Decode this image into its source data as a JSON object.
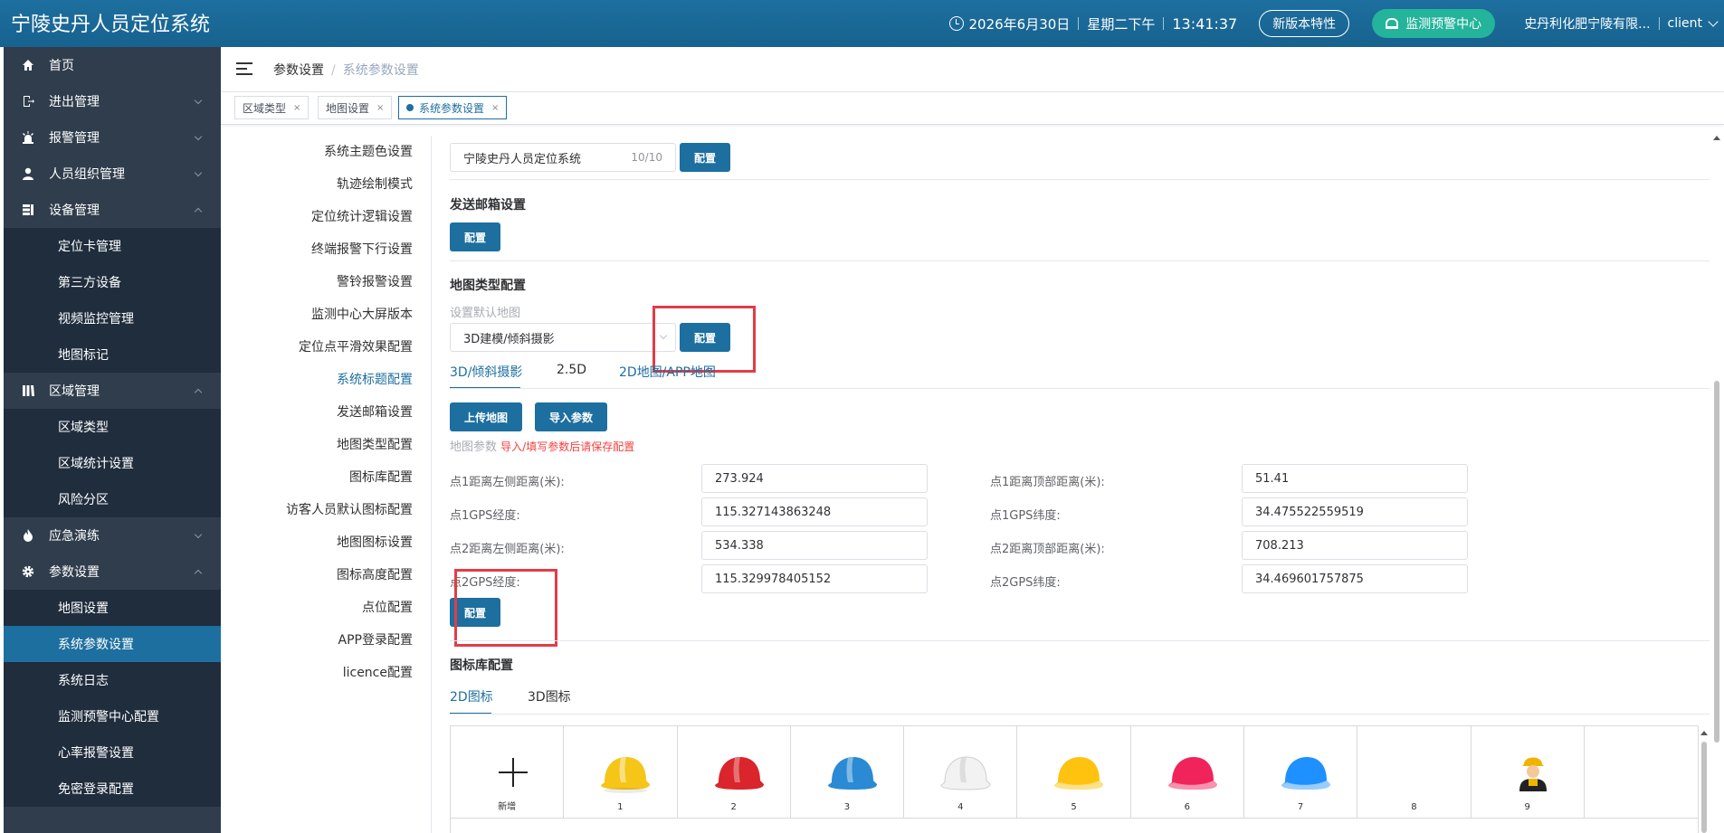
{
  "header": {
    "title": "宁陵史丹人员定位系统",
    "date": "2026年6月30日",
    "weekday": "星期二下午",
    "time": "13:41:37",
    "new_features": "新版本特性",
    "alarm_center": "监测预警中心",
    "company": "史丹利化肥宁陵有限...",
    "user": "client"
  },
  "colors": {
    "primary": "#1d6f9f",
    "sidebar": "#2f3d4c",
    "alarm": "#24b39b",
    "highlight_box": "#e23c48"
  },
  "sidebar": {
    "items": [
      {
        "label": "首页",
        "icon": "home-icon"
      },
      {
        "label": "进出管理",
        "icon": "exit-icon",
        "arrow": "down"
      },
      {
        "label": "报警管理",
        "icon": "alarm-light-icon",
        "arrow": "down"
      },
      {
        "label": "人员组织管理",
        "icon": "user-icon",
        "arrow": "down"
      },
      {
        "label": "设备管理",
        "icon": "device-icon",
        "arrow": "up"
      }
    ],
    "device_sub": [
      "定位卡管理",
      "第三方设备",
      "视频监控管理",
      "地图标记"
    ],
    "area": {
      "label": "区域管理",
      "icon": "area-icon"
    },
    "area_sub": [
      "区域类型",
      "区域统计设置",
      "风险分区"
    ],
    "drill": {
      "label": "应急演练",
      "icon": "fire-icon"
    },
    "params": {
      "label": "参数设置",
      "icon": "gear-icon"
    },
    "params_sub": [
      "地图设置",
      "系统参数设置",
      "系统日志",
      "监测预警中心配置",
      "心率报警设置",
      "免密登录配置"
    ]
  },
  "breadcrumb": {
    "parent": "参数设置",
    "current": "系统参数设置"
  },
  "tabs": [
    "区域类型",
    "地图设置",
    "系统参数设置"
  ],
  "settings_nav": [
    "系统主题色设置",
    "轨迹绘制模式",
    "定位统计逻辑设置",
    "终端报警下行设置",
    "警铃报警设置",
    "监测中心大屏版本",
    "定位点平滑效果配置",
    "系统标题配置",
    "发送邮箱设置",
    "地图类型配置",
    "图标库配置",
    "访客人员默认图标配置",
    "地图图标设置",
    "图标高度配置",
    "点位配置",
    "APP登录配置",
    "licence配置"
  ],
  "title_config": {
    "value": "宁陵史丹人员定位系统",
    "count": "10/10",
    "button": "配置"
  },
  "mail": {
    "title": "发送邮箱设置",
    "button": "配置"
  },
  "map_type": {
    "title": "地图类型配置",
    "default_label": "设置默认地图",
    "selected": "3D建模/倾斜摄影",
    "button": "配置",
    "tabs": [
      "3D/倾斜摄影",
      "2.5D",
      "2D地图/APP地图"
    ],
    "upload": "上传地图",
    "import": "导入参数",
    "params_label": "地图参数",
    "params_hint": "导入/填写参数后请保存配置",
    "fields": [
      {
        "label": "点1距离左侧距离(米):",
        "value": "273.924",
        "label2": "点1距离顶部距离(米):",
        "value2": "51.41"
      },
      {
        "label": "点1GPS经度:",
        "value": "115.327143863248",
        "label2": "点1GPS纬度:",
        "value2": "34.475522559519"
      },
      {
        "label": "点2距离左侧距离(米):",
        "value": "534.338",
        "label2": "点2距离顶部距离(米):",
        "value2": "708.213"
      },
      {
        "label": "点2GPS经度:",
        "value": "115.329978405152",
        "label2": "点2GPS纬度:",
        "value2": "34.469601757875"
      }
    ],
    "save": "配置"
  },
  "icon_lib": {
    "title": "图标库配置",
    "tabs": [
      "2D图标",
      "3D图标"
    ],
    "add_label": "新增",
    "icons": [
      {
        "cap": "1",
        "color": "#f5c518",
        "icon": "yellow-helmet-icon"
      },
      {
        "cap": "2",
        "color": "#d9252b",
        "icon": "red-helmet-icon"
      },
      {
        "cap": "3",
        "color": "#2a8ad3",
        "icon": "blue-helmet-icon"
      },
      {
        "cap": "4",
        "color": "#f2f2f2",
        "icon": "white-helmet-icon"
      },
      {
        "cap": "5",
        "color": "#ffc20e",
        "icon": "yellow-helmet-icon"
      },
      {
        "cap": "6",
        "color": "#f0245a",
        "icon": "pink-helmet-icon"
      },
      {
        "cap": "7",
        "color": "#1e90ff",
        "icon": "blue-helmet-icon"
      },
      {
        "cap": "8",
        "color": "",
        "icon": ""
      },
      {
        "cap": "9",
        "color": "#f0b400",
        "icon": "worker-icon"
      }
    ]
  }
}
